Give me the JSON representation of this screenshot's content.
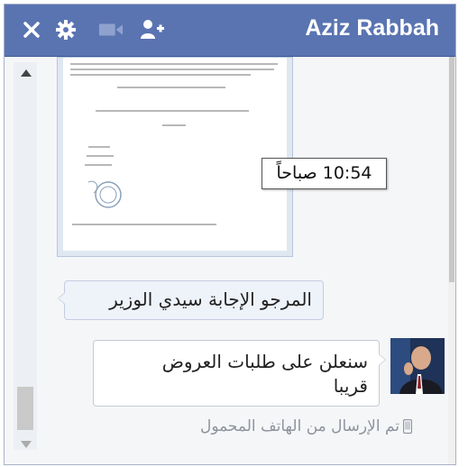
{
  "window": {
    "title": "Aziz Rabbah"
  },
  "toolbar": {
    "close_icon": "close-icon",
    "settings_icon": "gear-icon",
    "video_icon": "video-camera-icon",
    "add_people_icon": "add-person-icon"
  },
  "thread": {
    "timestamp_tooltip": "10:54 صباحاً",
    "messages": [
      {
        "direction": "outgoing",
        "text": "المرجو الإجابة سيدي الوزير"
      },
      {
        "direction": "incoming",
        "line1": "سنعلن على طلبات العروض",
        "line2": "قريبا"
      }
    ],
    "sent_from_mobile": "تم الإرسال من الهاتف المحمول"
  },
  "colors": {
    "header": "#5a74b2",
    "header_text": "#ffffff",
    "bubble_out": "#eef2f9"
  }
}
